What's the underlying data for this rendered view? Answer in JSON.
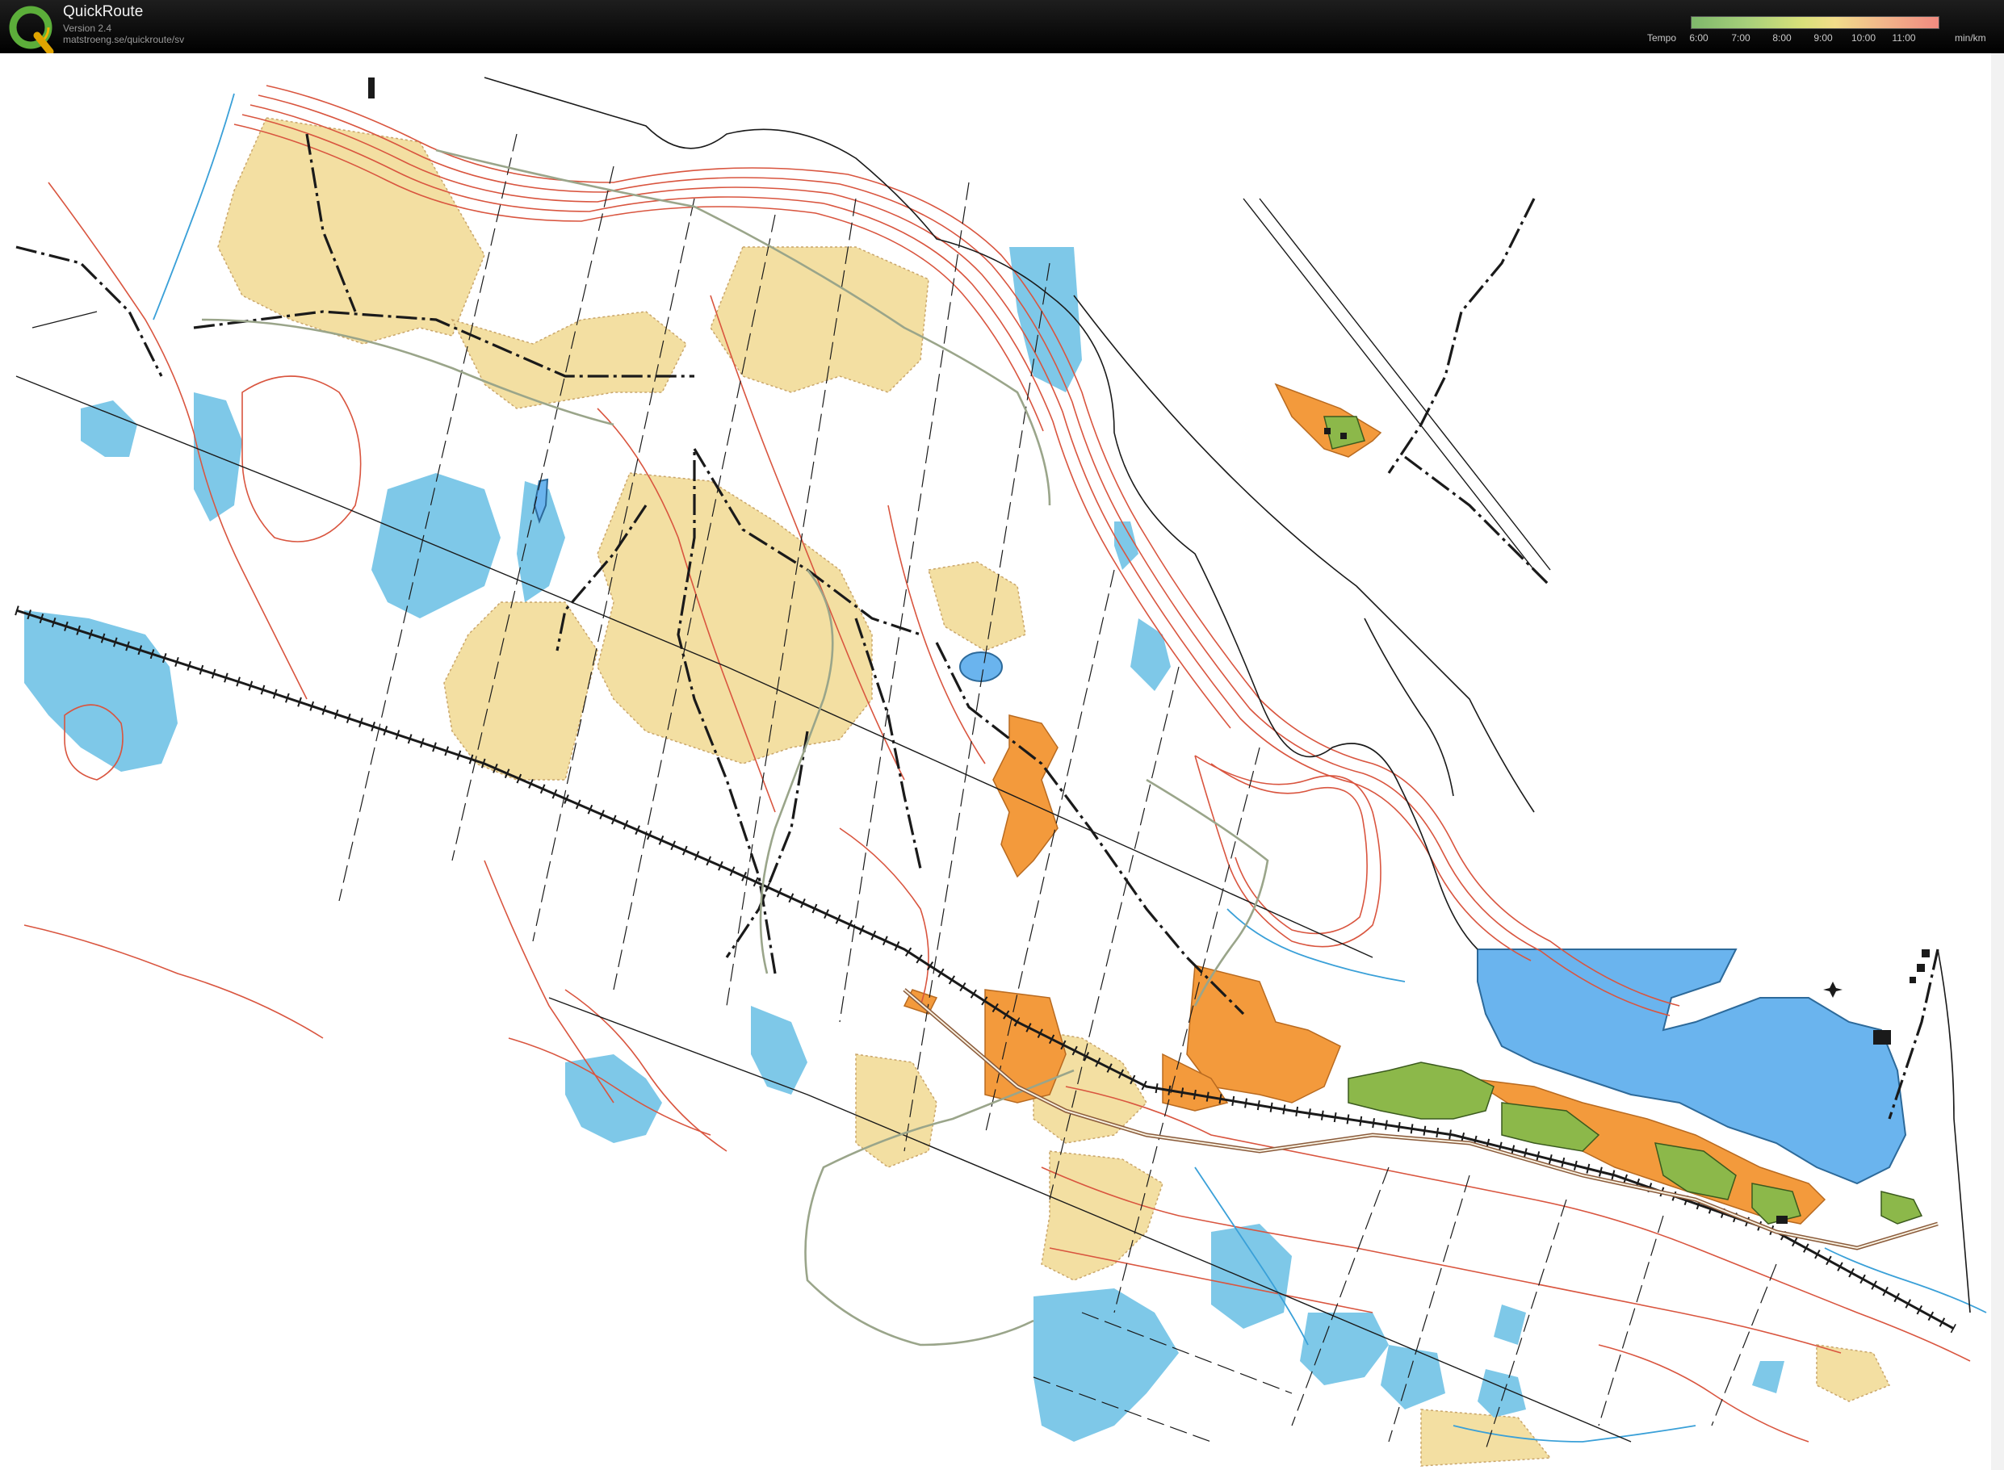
{
  "app": {
    "title": "QuickRoute",
    "version": "Version 2.4",
    "url": "matstroeng.se/quickroute/sv",
    "logo_letter": "Q"
  },
  "tempo": {
    "label": "Tempo",
    "ticks": [
      "6:00",
      "7:00",
      "8:00",
      "9:00",
      "10:00",
      "11:00"
    ],
    "unit": "min/km",
    "colors": [
      "#7fb86b",
      "#a6cf7a",
      "#d9e07a",
      "#f1dc8a",
      "#f2b58a",
      "#f08a80"
    ]
  },
  "map": {
    "colors": {
      "contour": "#d9553f",
      "water": "#7ec8e8",
      "lake": "#6ab4ee",
      "open_land": "#f3dfa2",
      "rough_open": "#f39a3c",
      "settlement": "#8cb84a",
      "path": "#1a1a1a",
      "trail": "#9aa58a",
      "stream": "#3aa0d8"
    }
  }
}
